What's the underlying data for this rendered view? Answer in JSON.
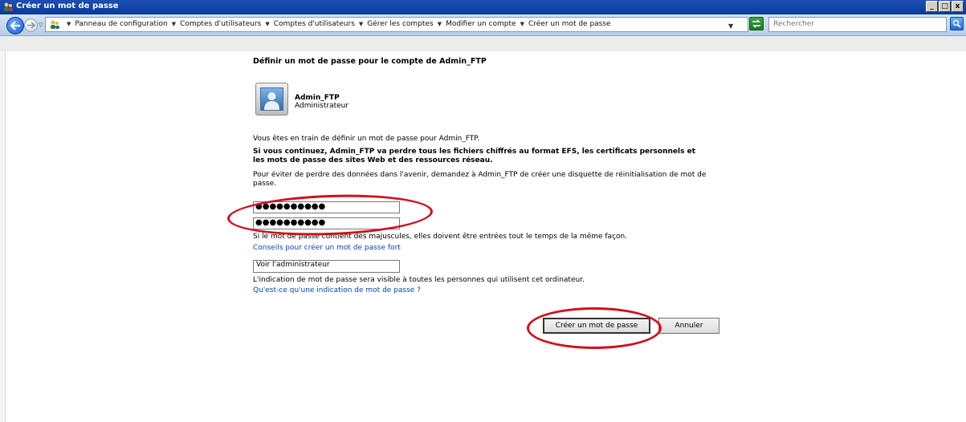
{
  "window": {
    "title": "Créer un mot de passe",
    "buttons": [
      "_",
      "□",
      "x"
    ]
  },
  "address_bar": {
    "breadcrumbs": [
      "Panneau de configuration",
      "Comptes d'utilisateurs",
      "Comptes d'utilisateurs",
      "Gérer les comptes",
      "Modifier un compte",
      "Créer un mot de passe"
    ],
    "search_placeholder": "Rechercher"
  },
  "page": {
    "title": "Définir un mot de passe pour le compte de Admin_FTP",
    "user_name": "Admin_FTP",
    "user_role": "Administrateur",
    "intro": "Vous êtes en train de définir un mot de passe pour Admin_FTP.",
    "warning": "Si vous continuez, Admin_FTP va perdre tous les fichiers chiffrés au format EFS, les certificats personnels et les mots de passe des sites Web et des ressources réseau.",
    "advice": "Pour éviter de perdre des données dans l'avenir, demandez à Admin_FTP de créer une disquette de réinitialisation de mot de passe.",
    "new_password_value": "●●●●●●●●●●",
    "confirm_password_value": "●●●●●●●●●●",
    "case_note": "Si le mot de passe contient des majuscules, elles doivent être entrées tout le temps de la même façon.",
    "strong_password_link": "Conseils pour créer un mot de passe fort",
    "hint_value": "Voir l'administrateur",
    "hint_note": "L'indication de mot de passe sera visible à toutes les personnes qui utilisent cet ordinateur.",
    "hint_link": "Qu'est-ce qu'une indication de mot de passe ?",
    "create_button": "Créer un mot de passe",
    "cancel_button": "Annuler"
  },
  "colors": {
    "titlebar": "#0a3a9c",
    "link": "#0645ad",
    "highlight": "#d0101c"
  }
}
